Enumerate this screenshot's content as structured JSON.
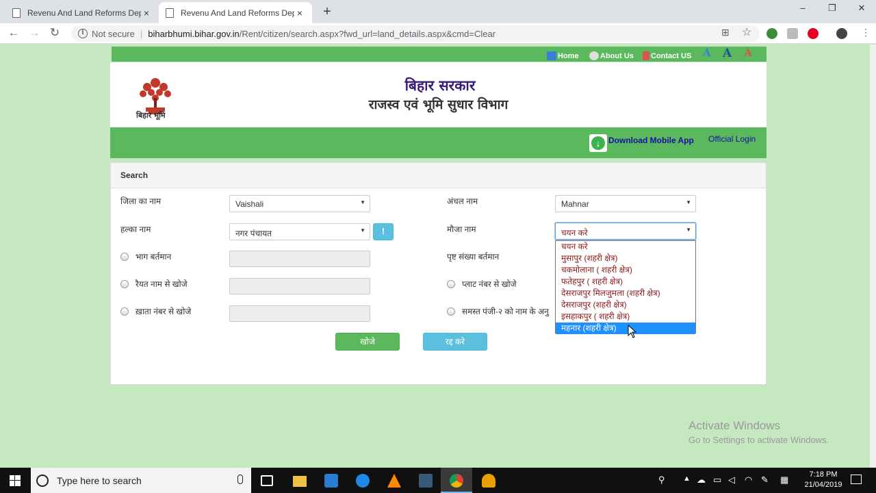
{
  "browser": {
    "tabs": [
      {
        "title": "Revenu And Land Reforms Depar",
        "close": "×"
      },
      {
        "title": "Revenu And Land Reforms Depar",
        "close": "×"
      }
    ],
    "new_tab": "+",
    "window": {
      "minimize": "–",
      "maximize": "❐",
      "close": "✕"
    },
    "nav": {
      "back": "←",
      "forward": "→",
      "reload": "↻"
    },
    "security": "Not secure",
    "url_host": "biharbhumi.bihar.gov.in",
    "url_path": "/Rent/citizen/search.aspx?fwd_url=land_details.aspx&cmd=Clear"
  },
  "topnav": {
    "home": "Home",
    "about": "About Us",
    "contact": "Contact US",
    "font_increase": "A",
    "font_normal": "A",
    "font_decrease": "A"
  },
  "header": {
    "logo_text": "बिहार भूमि",
    "title": "बिहार सरकार",
    "subtitle": "राजस्व एवं भूमि सुधार विभाग"
  },
  "greenbar": {
    "download": "Download Mobile App",
    "official_login": "Official Login"
  },
  "search": {
    "heading": "Search",
    "district_label": "जिला का नाम",
    "district_value": "Vaishali",
    "circle_label": "अंचल नाम",
    "circle_value": "Mahnar",
    "halka_label": "हल्का नाम",
    "halka_value": "नगर पंचायत",
    "info_btn": "!",
    "mauza_label": "मौजा नाम",
    "mauza_value": "चयन करे",
    "bhag_label": "भाग बर्तमान",
    "page_label": "पृष्ट संख्या बर्तमान",
    "raiyat_label": "रैयत नाम से खोजे",
    "plot_label": "प्लाट नंबर से खोजे",
    "khata_label": "ख़ाता नंबर से खोजे",
    "register_label": "समस्त पंजी-२ को नाम के अनु",
    "search_btn": "खोजे",
    "cancel_btn": "रद्द करे"
  },
  "mauza_options": [
    "चयन करे",
    "मुसापुर (शहरी क्षेत्र)",
    "चकमोलाना ( शहरी क्षेत्र)",
    "फतेहपुर ( शहरी क्षेत्र)",
    "देसराजपुर मिलजुमला (शहरी क्षेत्र)",
    "देसराजपुर (शहरी क्षेत्र)",
    "इसहाकपुर ( शहरी क्षेत्र)",
    "महनार (शहरी क्षेत्र)"
  ],
  "mauza_highlighted_index": 7,
  "watermark": {
    "line1": "Activate Windows",
    "line2": "Go to Settings to activate Windows."
  },
  "taskbar": {
    "search_placeholder": "Type here to search",
    "time": "7:18 PM",
    "date": "21/04/2019"
  },
  "colors": {
    "page_bg": "#c5e8c0",
    "green": "#5cb85c",
    "info_blue": "#5bc0de",
    "highlight": "#1e90ff",
    "option_text": "#8b1a1a"
  }
}
